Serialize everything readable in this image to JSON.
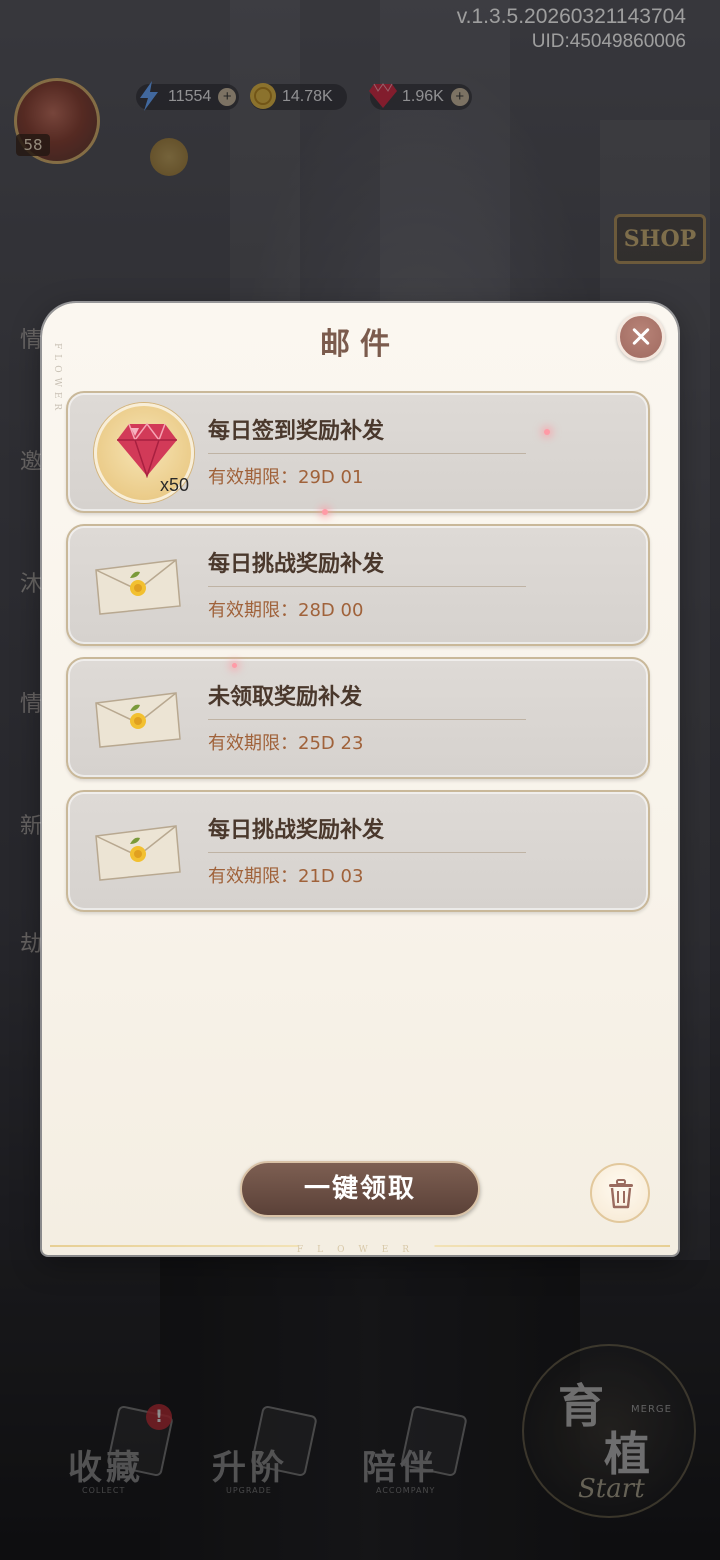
{
  "hud": {
    "version": "v.1.3.5.20260321143704",
    "uid": "UID:45049860006",
    "level": "58",
    "resources": [
      {
        "name": "energy",
        "icon": "lightning-icon",
        "value": "11554"
      },
      {
        "name": "gold",
        "icon": "coin-icon",
        "value": "14.78K"
      },
      {
        "name": "gems",
        "icon": "ruby-icon",
        "value": "1.96K"
      }
    ],
    "shop_sign": "SHOP"
  },
  "mail_dialog": {
    "title": "邮件",
    "side_text": "FLOWER",
    "bottom_text": "FLOWER",
    "items": [
      {
        "title": "每日签到奖励补发",
        "expiry": "有效期限：29D 01",
        "attachment": "ruby-icon",
        "quantity": "x50"
      },
      {
        "title": "每日挑战奖励补发",
        "expiry": "有效期限：28D 00",
        "attachment": "letter-icon"
      },
      {
        "title": "未领取奖励补发",
        "expiry": "有效期限：25D 23",
        "attachment": "letter-icon"
      },
      {
        "title": "每日挑战奖励补发",
        "expiry": "有效期限：21D 03",
        "attachment": "letter-icon"
      }
    ],
    "claim_all_label": "一键领取"
  },
  "side_menu": [
    "情",
    "邀",
    "沐",
    "情",
    "新",
    "劫"
  ],
  "bottom_nav": {
    "items": [
      {
        "zh": "收藏",
        "en": "COLLECT"
      },
      {
        "zh": "升阶",
        "en": "UPGRADE"
      },
      {
        "zh": "陪伴",
        "en": "ACCOMPANY"
      }
    ],
    "notification": "!",
    "start": {
      "zh_top": "育",
      "zh_bottom": "植",
      "merge": "MERGE",
      "start": "Start"
    }
  },
  "colors": {
    "dialog_bg": "#fbf7f0",
    "title": "#7b5b4d",
    "expiry": "#a0623a",
    "button": "#6b5046",
    "close": "#a87a6f"
  }
}
